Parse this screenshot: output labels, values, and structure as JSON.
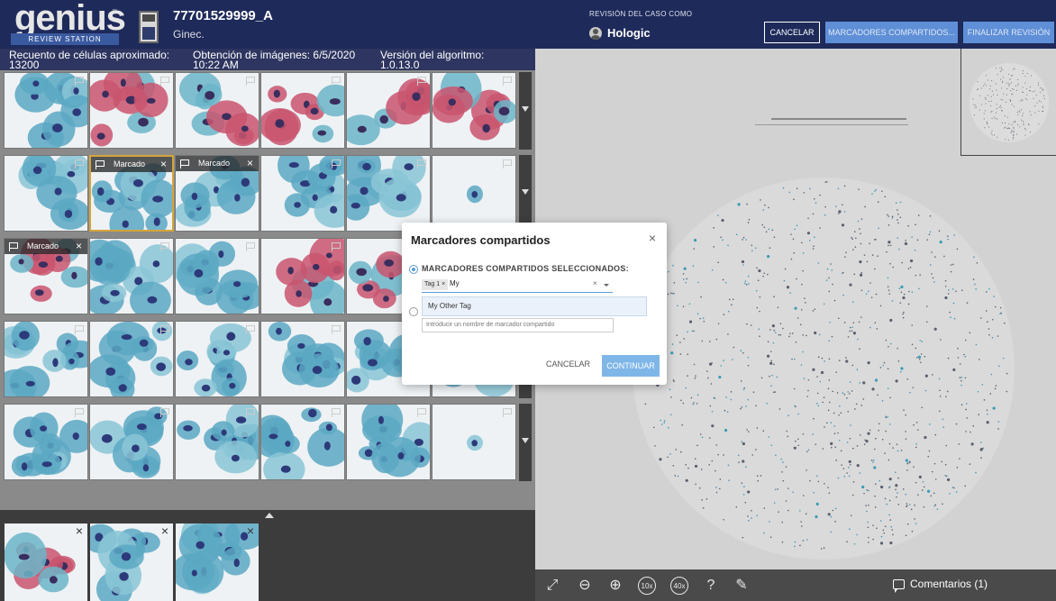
{
  "header": {
    "logo_text": "genius",
    "logo_tm": "™",
    "logo_subtitle": "REVIEW STATION",
    "case_id": "77701529999_A",
    "case_type": "Ginec.",
    "review_as_label": "REVISIÓN DEL CASO COMO",
    "reviewer": "Hologic",
    "buttons": {
      "cancel": "CANCELAR",
      "shared_tags": "MARCADORES COMPARTIDOS...",
      "finish_review": "FINALIZAR REVISIÓN"
    }
  },
  "info_bar": {
    "cell_count": "Recuento de células aproximado: 13200",
    "imaging": "Obtención de imágenes: 6/5/2020 10:22 AM",
    "algorithm": "Versión del algoritmo: 1.0.13.0"
  },
  "gallery": {
    "marked_label": "Marcado",
    "rows": [
      {
        "tiles": [
          {
            "type": "blue",
            "marked": false
          },
          {
            "type": "pink",
            "marked": false
          },
          {
            "type": "pink",
            "marked": false
          },
          {
            "type": "pink",
            "marked": false
          },
          {
            "type": "pink",
            "marked": false
          },
          {
            "type": "pink",
            "marked": false
          }
        ]
      },
      {
        "tiles": [
          {
            "type": "blue",
            "marked": false
          },
          {
            "type": "blue",
            "marked": true,
            "selected": true
          },
          {
            "type": "blue",
            "marked": true
          },
          {
            "type": "blue",
            "marked": false
          },
          {
            "type": "blue",
            "marked": false
          },
          {
            "type": "single",
            "marked": false
          }
        ]
      },
      {
        "tiles": [
          {
            "type": "pink",
            "marked": true
          },
          {
            "type": "blue",
            "marked": false
          },
          {
            "type": "blue",
            "marked": false
          },
          {
            "type": "pink",
            "marked": false
          },
          {
            "type": "pink",
            "marked": false
          },
          {
            "type": "blue",
            "marked": false
          }
        ]
      },
      {
        "tiles": [
          {
            "type": "blue",
            "marked": false
          },
          {
            "type": "blue",
            "marked": false
          },
          {
            "type": "blue",
            "marked": false
          },
          {
            "type": "blue",
            "marked": false
          },
          {
            "type": "blue",
            "marked": false
          },
          {
            "type": "blue",
            "marked": false
          }
        ]
      },
      {
        "tiles": [
          {
            "type": "blue",
            "marked": false
          },
          {
            "type": "blue",
            "marked": false
          },
          {
            "type": "blue",
            "marked": false
          },
          {
            "type": "blue",
            "marked": false
          },
          {
            "type": "blue",
            "marked": false
          },
          {
            "type": "single",
            "marked": false
          }
        ]
      }
    ]
  },
  "strip": {
    "tiles": [
      {
        "type": "pink"
      },
      {
        "type": "blue"
      },
      {
        "type": "blue"
      }
    ],
    "close_glyph": "×"
  },
  "toolbar": {
    "tools": [
      "expand-icon",
      "zoom-out-icon",
      "zoom-in-icon",
      "zoom-10x-icon",
      "zoom-40x-icon",
      "help-icon",
      "pen-icon"
    ],
    "zoom_10": "10x",
    "zoom_40": "40x",
    "help": "?",
    "comments": "Comentarios (1)"
  },
  "modal": {
    "title": "Marcadores compartidos",
    "close": "×",
    "option_selected_label": "MARCADORES COMPARTIDOS SELECCIONADOS:",
    "chip": "Tag 1 ×",
    "typed_value": "My",
    "clear": "×",
    "suggestion": "My Other Tag",
    "new_tag_placeholder": "Introducir un nombre de marcador compartido",
    "cancel": "CANCELAR",
    "continue": "CONTINUAR"
  },
  "colors": {
    "header_bg": "#1e2a5a",
    "accent": "#5f8fd6",
    "selected_tile_border": "#d4a43a"
  }
}
